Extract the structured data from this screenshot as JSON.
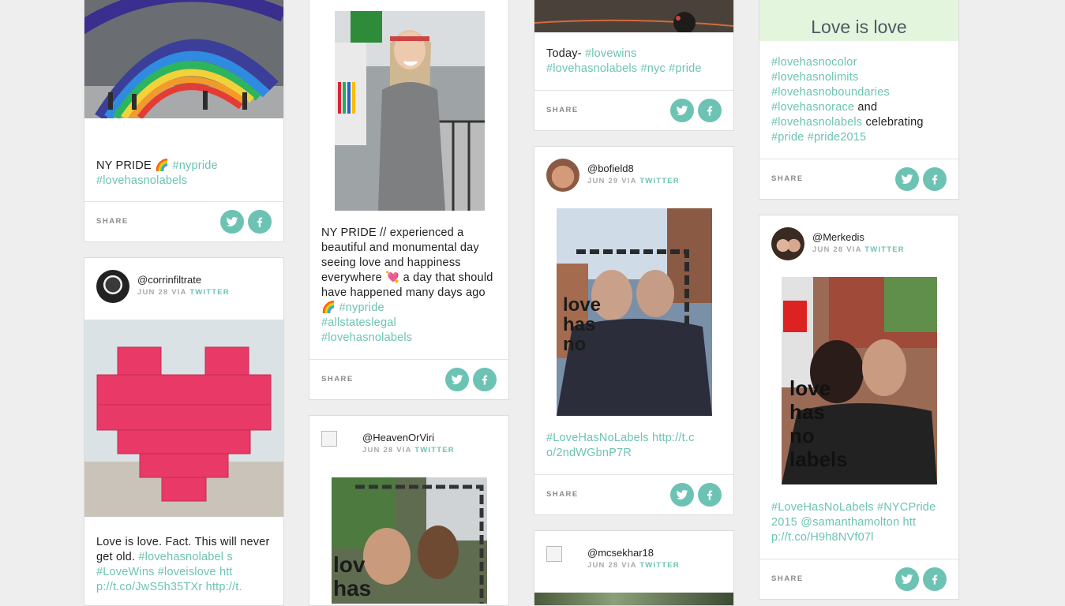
{
  "share_label": "SHARE",
  "accent_color": "#6cc3b3",
  "icons": {
    "twitter": "twitter-icon",
    "facebook": "facebook-icon"
  },
  "cards": {
    "c1": {
      "text": "NY PRIDE 🌈",
      "tags": [
        "#nypride",
        "#lovehasnolabels"
      ]
    },
    "c2": {
      "handle": "@corrinfiltrate",
      "date": "JUN 28",
      "via": "VIA",
      "network": "TWITTER",
      "text": "Love is love. Fact. This will never get old.",
      "tags": [
        "#lovehasnolabel s",
        "#LoveWins",
        "#loveislove",
        "htt p://t.co/JwS5h35TXr",
        "http://t."
      ]
    },
    "c3": {
      "text": "NY PRIDE // experienced a beautiful and monumental day seeing love and happiness everywhere 💘 a day that should have happened many days ago 🌈",
      "tags": [
        "#nypride",
        "#allstateslegal",
        "#lovehasnolabels"
      ]
    },
    "c4": {
      "handle": "@HeavenOrViri",
      "date": "JUN 28",
      "via": "VIA",
      "network": "TWITTER"
    },
    "c5": {
      "text": "Today-",
      "tags": [
        "#lovewins",
        "#lovehasnolabels",
        "#nyc",
        "#pride"
      ]
    },
    "c6": {
      "handle": "@bofield8",
      "date": "JUN 29",
      "via": "VIA",
      "network": "TWITTER",
      "tags": [
        "#LoveHasNoLabels",
        "http://t.c o/2ndWGbnP7R"
      ]
    },
    "c7": {
      "handle": "@mcsekhar18",
      "date": "JUN 28",
      "via": "VIA",
      "network": "TWITTER"
    },
    "c8": {
      "banner": "Love is love",
      "tags": [
        "#lovehasnocolor",
        "#lovehasnolimits",
        "#lovehasnoboundaries",
        "#lovehasnorace"
      ],
      "and": "and",
      "tag5": "#lovehasnolabels",
      "celebrating": "celebrating",
      "tags_end": [
        "#pride",
        "#pride2015"
      ]
    },
    "c9": {
      "handle": "@Merkedis",
      "date": "JUN 28",
      "via": "VIA",
      "network": "TWITTER",
      "tags": [
        "#LoveHasNoLabels",
        "#NYCPride 2015",
        "@samanthamolton",
        "htt p://t.co/H9h8NVf07l"
      ]
    }
  }
}
